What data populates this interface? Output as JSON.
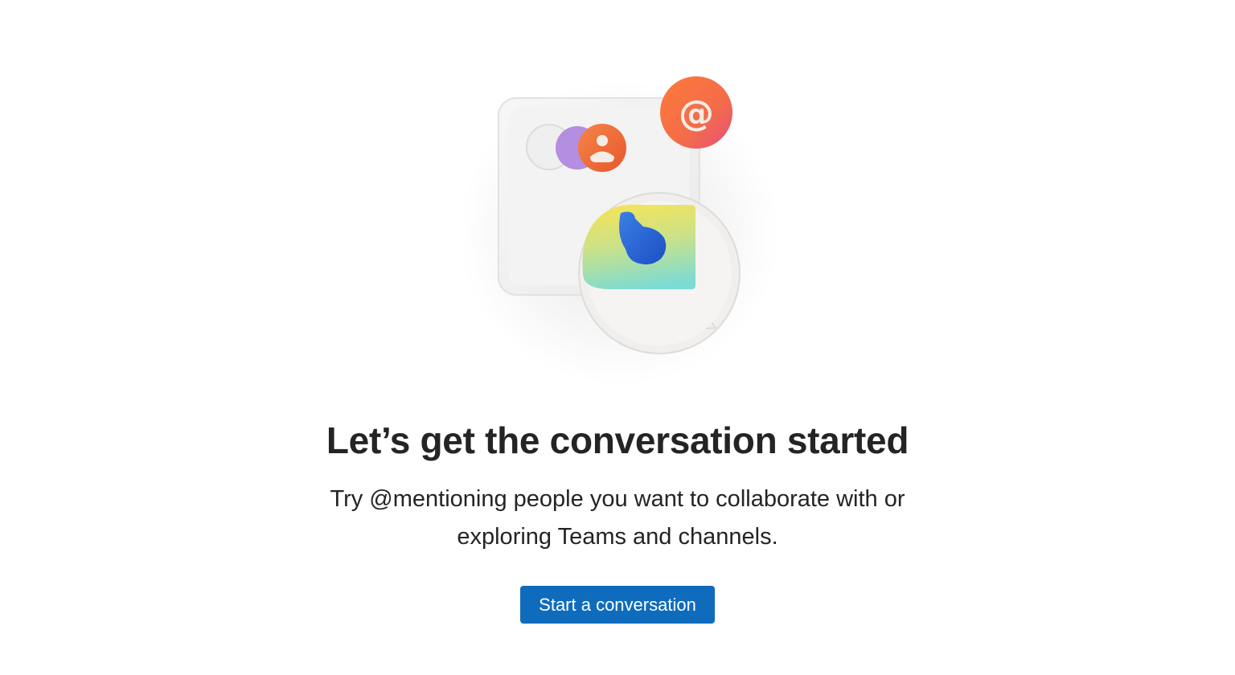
{
  "empty_state": {
    "illustration_icon": "chat-mention-illustration-icon",
    "title": "Let’s get the conversation started",
    "subtitle": "Try @mentioning people you want to collaborate with or exploring Teams and channels.",
    "cta_label": "Start a conversation"
  },
  "colors": {
    "accent": "#0f6cbd",
    "text": "#242424",
    "mention_orange": "#ee6a3a",
    "avatar_purple": "#b48ee0"
  }
}
